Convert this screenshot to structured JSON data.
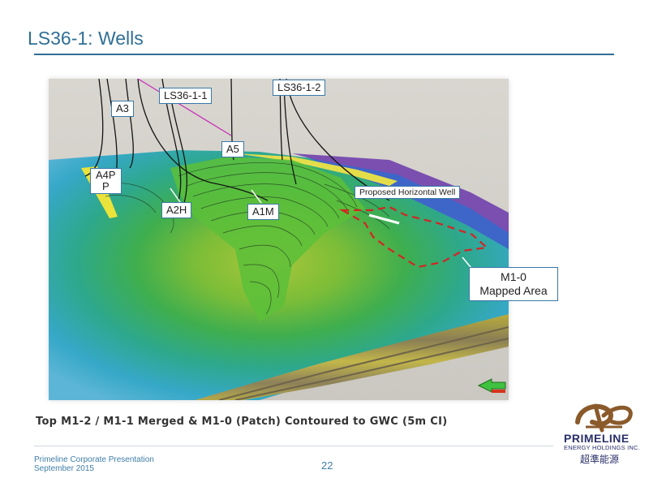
{
  "slide": {
    "title": "LS36-1: Wells",
    "caption": "Top M1-2 / M1-1 Merged & M1-0 (Patch) Contoured to GWC (5m CI)",
    "page_number": "22"
  },
  "figure_labels": {
    "a3": "A3",
    "ls36_1_1": "LS36-1-1",
    "ls36_1_2": "LS36-1-2",
    "a5": "A5",
    "a4p": "A4P\nP",
    "a2h": "A2H",
    "a1m": "A1M",
    "proposed_well": "Proposed Horizontal Well",
    "m1_0": "M1-0\nMapped Area"
  },
  "footer": {
    "line1": "Primeline Corporate Presentation",
    "line2": "September 2015"
  },
  "logo": {
    "name": "PRIMELINE",
    "subtitle": "ENERGY HOLDINGS INC.",
    "chinese": "超準能源"
  },
  "colors": {
    "accent": "#2f6f95",
    "label_border": "#3a78a6",
    "logo_brown": "#8a5a2b",
    "logo_navy": "#2a2f6a"
  }
}
